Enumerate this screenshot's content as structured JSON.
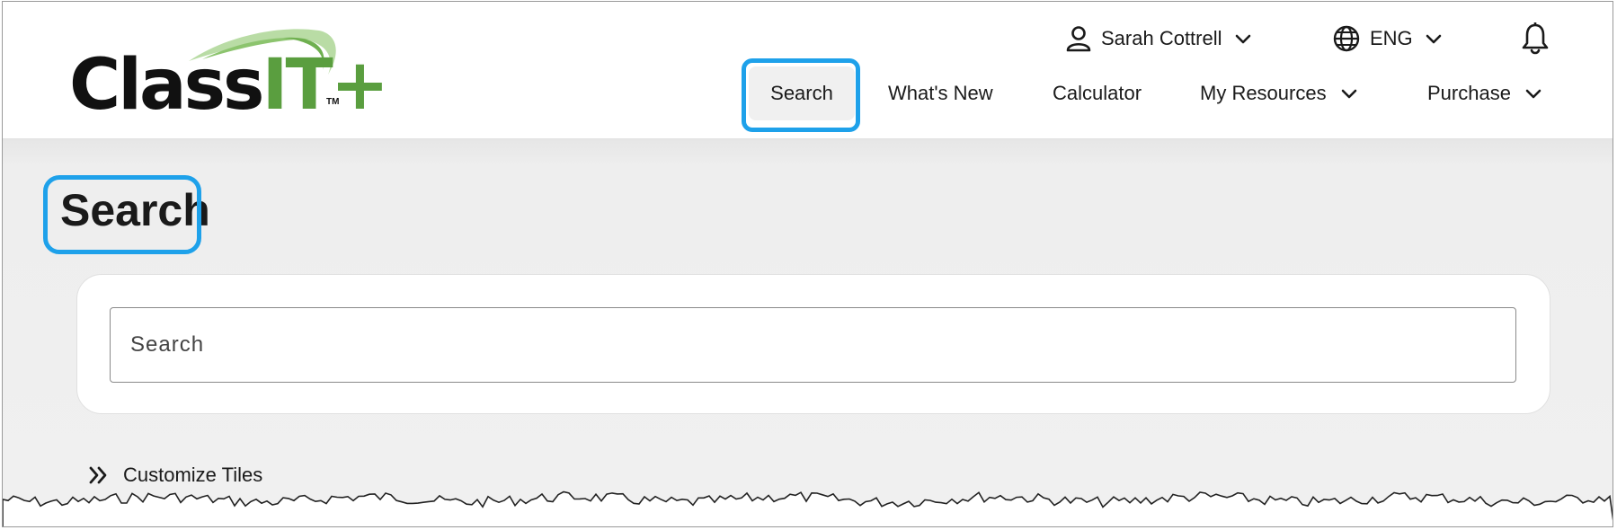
{
  "logo": {
    "brand_black": "Class",
    "brand_green": "IT+",
    "trademark": "TM"
  },
  "header": {
    "user_name": "Sarah Cottrell",
    "language": "ENG"
  },
  "nav": {
    "items": [
      {
        "label": "Search",
        "active": true
      },
      {
        "label": "What's New"
      },
      {
        "label": "Calculator"
      },
      {
        "label": "My Resources",
        "has_dropdown": true
      },
      {
        "label": "Purchase",
        "has_dropdown": true
      }
    ]
  },
  "page": {
    "title": "Search",
    "search_placeholder": "Search",
    "customize_label": "Customize Tiles"
  },
  "icons": {
    "user": "user-icon",
    "language": "globe-icon",
    "notifications": "bell-icon",
    "dropdown": "chevron-down-icon",
    "customize": "double-chevron-right-icon"
  },
  "colors": {
    "highlight": "#1ea1ea",
    "brand_green": "#5a9e3f",
    "text": "#1a1a1a",
    "page_background": "#f0f0f0"
  }
}
